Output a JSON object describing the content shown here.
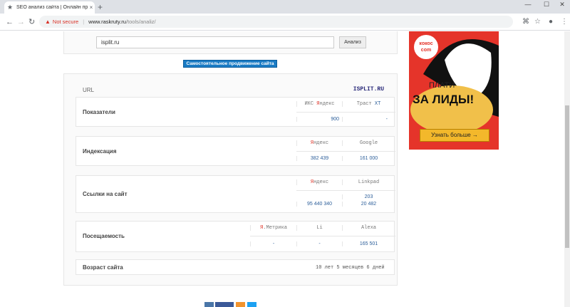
{
  "browser": {
    "tab_title": "SEO анализ сайта | Онлайн про...",
    "tab_close": "×",
    "new_tab": "+",
    "warning_icon": "▲",
    "not_secure": "Not secure",
    "url_host": "www.raskruty.ru",
    "url_path": "/tools/analiz/"
  },
  "search": {
    "value": "isplit.ru",
    "button": "Анализ"
  },
  "promo_button": "Самостоятельное продвижение сайта",
  "results": {
    "url_label": "URL",
    "url_value": "ISPLIT.RU",
    "indicators": {
      "label": "Показатели",
      "h1_pre": "ИКС ",
      "h1_ya": "Я",
      "h1_post": "ндекс",
      "h2_pre": "Траст ",
      "h2_xt": "XT",
      "v1": "900",
      "v2": "-"
    },
    "indexing": {
      "label": "Индексация",
      "h1_ya": "Я",
      "h1_post": "ндекс",
      "h2": "Google",
      "v1": "382 439",
      "v2": "161 000"
    },
    "links": {
      "label": "Ссылки на сайт",
      "h1_ya": "Я",
      "h1_post": "ндекс",
      "h2": "Linkpad",
      "v1": "95 440 340",
      "v2a": "203",
      "v2b": "20 482"
    },
    "traffic": {
      "label": "Посещаемость",
      "h1_ya": "Я",
      "h1_post": ".Метрика",
      "h2": "Li",
      "h3": "Alexa",
      "v1": "-",
      "v2": "-",
      "v3": "165 501"
    },
    "age": {
      "label": "Возраст сайта",
      "value": "10 лет 5 месяцев 6 дней"
    }
  },
  "ad": {
    "logo_top": "кокос",
    "logo_bottom": "com",
    "line1": "ПЛАТИ",
    "line2": "ЗА ЛИДЫ!",
    "button": "Узнать больше →"
  },
  "colors": {
    "ad_bg": "#e5342a",
    "promo_bg": "#1a7bc4",
    "yandex_red": "#e03a2f",
    "value_blue": "#2d5f9a"
  }
}
